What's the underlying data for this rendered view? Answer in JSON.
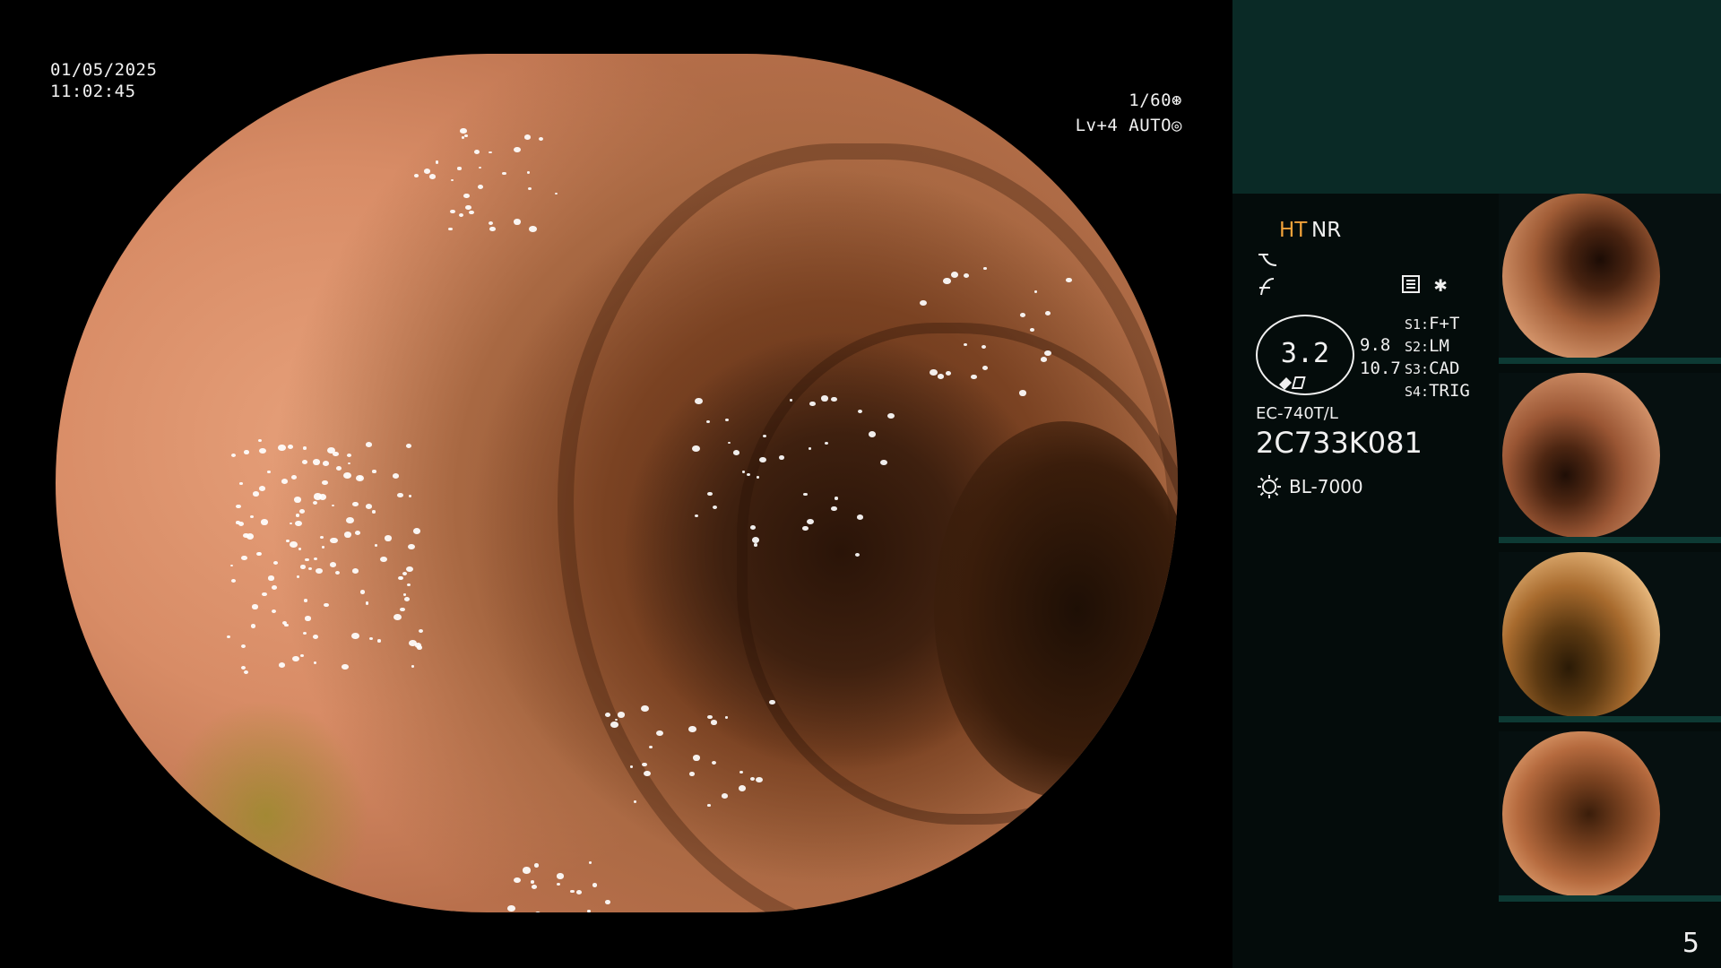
{
  "view": {
    "date": "01/05/2025",
    "time": "11:02:45",
    "shutter": "1/60",
    "level": "Lv+4 AUTO"
  },
  "panel": {
    "ht": "HT",
    "nr": "NR",
    "gauge_value": "3.2",
    "gauge_side_1": "9.8",
    "gauge_side_2": "10.7",
    "scope_keys": [
      {
        "key": "S1:",
        "value": "F+T"
      },
      {
        "key": "S2:",
        "value": "LM"
      },
      {
        "key": "S3:",
        "value": "CAD"
      },
      {
        "key": "S4:",
        "value": "TRIG"
      }
    ],
    "model": "EC-740T/L",
    "serial": "2C733K081",
    "lamp": "BL-7000"
  },
  "page_number": "5",
  "colors": {
    "ht_accent": "#f2a23a",
    "panel_top": "#0a2a26",
    "panel_bottom": "#040c0b"
  },
  "icons": [
    "shutter-icon",
    "iris-icon",
    "curve-icon",
    "edge-icon",
    "memo-icon",
    "star-icon",
    "lamp-icon"
  ]
}
